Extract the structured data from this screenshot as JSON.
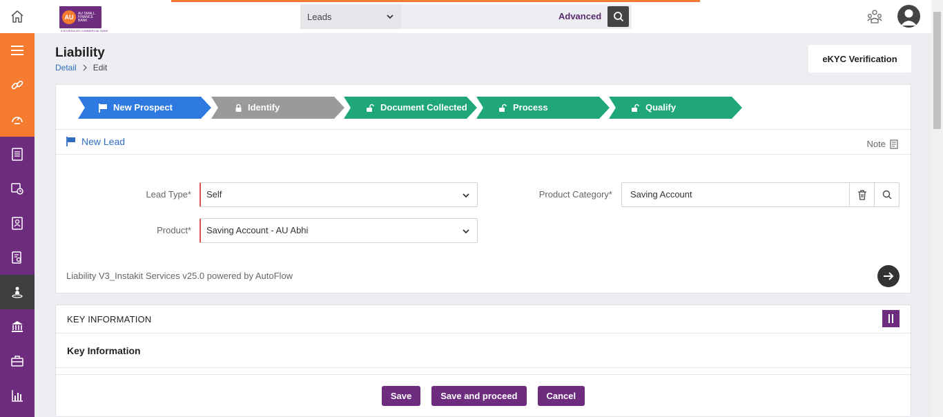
{
  "colors": {
    "brand_purple": "#6d2c7e",
    "brand_orange": "#f47b30",
    "step_blue": "#2f7ae0",
    "step_gray": "#9a9a9a",
    "step_green": "#1fa67a"
  },
  "header": {
    "logo_text": "AU",
    "logo_subtext": "AU SMALL FINANCE BANK",
    "logo_tagline": "A SCHEDULED COMMERCIAL BANK",
    "search_scope": "Leads",
    "advanced_label": "Advanced",
    "icons": [
      "home-icon",
      "search-icon",
      "people-network-icon",
      "user-avatar-icon"
    ]
  },
  "sidebar": {
    "items": [
      {
        "icon": "menu-icon"
      },
      {
        "icon": "link-icon"
      },
      {
        "icon": "dashboard-gauge-icon"
      },
      {
        "icon": "clipboard-list-icon"
      },
      {
        "icon": "calendar-clock-icon"
      },
      {
        "icon": "contact-book-icon"
      },
      {
        "icon": "document-search-icon"
      },
      {
        "icon": "person-pin-icon",
        "active": true
      },
      {
        "icon": "bank-icon"
      },
      {
        "icon": "briefcase-icon"
      },
      {
        "icon": "bar-chart-icon"
      }
    ]
  },
  "page": {
    "title": "Liability",
    "breadcrumb": {
      "detail": "Detail",
      "edit": "Edit"
    },
    "ekyc_button": "eKYC Verification"
  },
  "stepper": {
    "steps": [
      {
        "label": "New Prospect",
        "icon": "flag-icon",
        "state": "current"
      },
      {
        "label": "Identify",
        "icon": "lock-icon",
        "state": "locked"
      },
      {
        "label": "Document Collected",
        "icon": "unlock-icon",
        "state": "open"
      },
      {
        "label": "Process",
        "icon": "unlock-icon",
        "state": "open"
      },
      {
        "label": "Qualify",
        "icon": "unlock-icon",
        "state": "open"
      }
    ]
  },
  "section": {
    "title": "New Lead",
    "note_label": "Note"
  },
  "form": {
    "lead_type_label": "Lead Type*",
    "lead_type_value": "Self",
    "product_label": "Product*",
    "product_value": "Saving Account - AU Abhi",
    "product_category_label": "Product Category*",
    "product_category_value": "Saving Account"
  },
  "footer_text": "Liability V3_Instakit Services v25.0 powered by AutoFlow",
  "key_info": {
    "header": "KEY INFORMATION",
    "subtitle": "Key Information"
  },
  "actions": {
    "save": "Save",
    "save_proceed": "Save and proceed",
    "cancel": "Cancel"
  }
}
